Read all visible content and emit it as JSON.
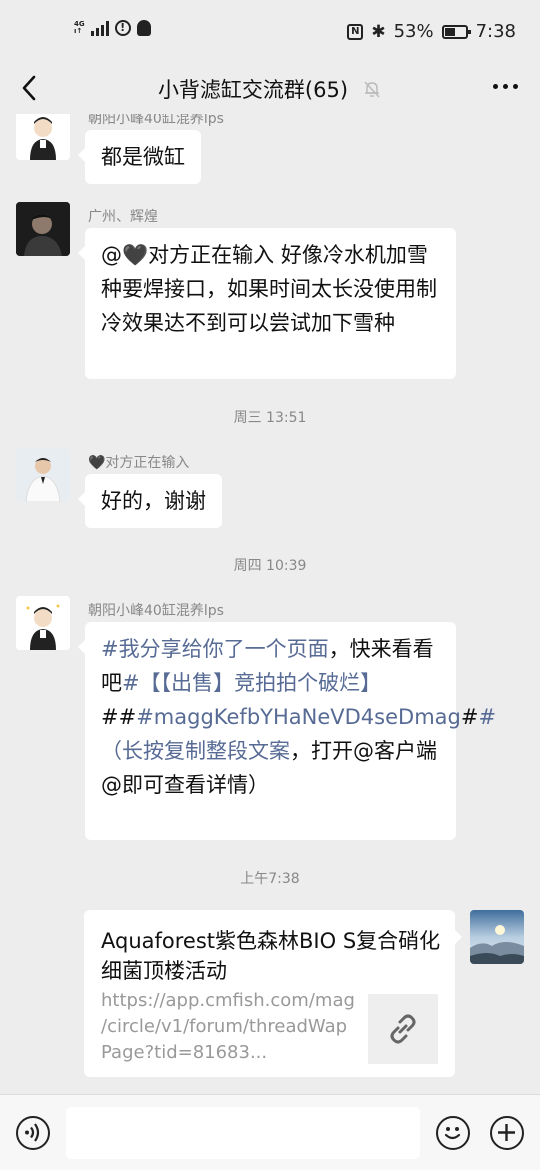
{
  "status_bar": {
    "network": "4G",
    "battery": "53%",
    "battery_level": 0.53,
    "time": "7:38"
  },
  "nav": {
    "title": "小背滤缸交流群(65)"
  },
  "messages": [
    {
      "sender": "朝阳小峰40缸混养lps",
      "text": "都是微缸"
    },
    {
      "sender": "广州、辉煌",
      "text": "@🖤对方正在输入  好像冷水机加雪种要焊接口，如果时间太长没使用制冷效果达不到可以尝试加下雪种"
    },
    {
      "timestamp": "周三 13:51"
    },
    {
      "sender": "🖤对方正在输入",
      "text": "好的，谢谢"
    },
    {
      "timestamp": "周四 10:39"
    },
    {
      "sender": "朝阳小峰40缸混养lps",
      "parts": [
        {
          "text": "#我分享给你了一个页面",
          "link": true
        },
        {
          "text": "，快来看看吧",
          "link": false
        },
        {
          "text": "#【【出售】竞拍拍个破烂】",
          "link": true
        },
        {
          "text": "##",
          "link": false
        },
        {
          "text": "#maggKefbYHaNeVD4seDmag",
          "link": true
        },
        {
          "text": "#",
          "link": false
        },
        {
          "text": "#（长按复制整段文案",
          "link": true
        },
        {
          "text": "，打开@客户端@即可查看详情）",
          "link": false
        }
      ]
    },
    {
      "timestamp": "上午7:38"
    },
    {
      "sender": "self",
      "link_card": {
        "title": "Aquaforest紫色森林BIO S复合硝化细菌顶楼活动",
        "url": "https://app.cmfish.com/mag/circle/v1/forum/threadWapPage?tid=81683..."
      }
    }
  ],
  "input": {
    "placeholder": ""
  }
}
